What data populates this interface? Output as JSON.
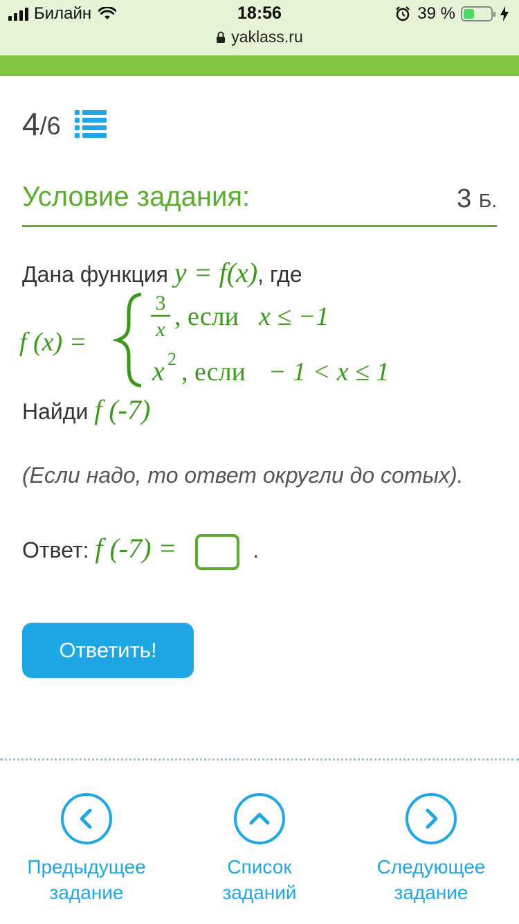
{
  "status_bar": {
    "carrier": "Билайн",
    "time": "18:56",
    "battery": "39 %",
    "battery_level": 0.39,
    "url": "yaklass.ru"
  },
  "counter": {
    "current": "4",
    "total": "/6"
  },
  "task": {
    "title": "Условие задания:",
    "points": "3",
    "points_unit": "Б."
  },
  "problem": {
    "intro_text": "Дана функция",
    "intro_math": "y = f(x)",
    "intro_suffix": ", где",
    "piecewise": {
      "lhs": "f (x) =",
      "case1_num": "3",
      "case1_den": "x",
      "case1_cond": ", если",
      "case1_ineq": "x ≤ −1",
      "case2_base": "x",
      "case2_exp": "2",
      "case2_cond": ", если",
      "case2_ineq": "− 1 < x ≤ 1"
    },
    "find_text": "Найди",
    "find_math": "f (-7)",
    "hint": "(Если надо, то ответ округли до сотых).",
    "answer_label": "Ответ:",
    "answer_math": "f (-7) =",
    "answer_value": "",
    "answer_period": "."
  },
  "submit_label": "Ответить!",
  "nav": {
    "prev": {
      "line1": "Предыдущее",
      "line2": "задание"
    },
    "list": {
      "line1": "Список",
      "line2": "заданий"
    },
    "next": {
      "line1": "Следующее",
      "line2": "задание"
    }
  },
  "colors": {
    "green": "#5aab2e",
    "math_green": "#3a9a1a",
    "blue": "#1ea7e4",
    "header_green": "#82c341"
  }
}
